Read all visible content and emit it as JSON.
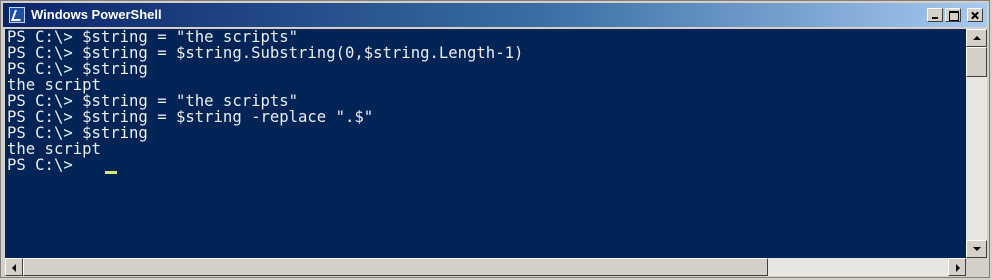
{
  "window": {
    "title": "Windows PowerShell",
    "icon": "powershell-icon"
  },
  "console": {
    "background": "#012456",
    "foreground": "#eeedf0",
    "cursor_color": "#d6e87c",
    "lines": [
      "PS C:\\> $string = \"the scripts\"",
      "PS C:\\> $string = $string.Substring(0,$string.Length-1)",
      "PS C:\\> $string",
      "the script",
      "PS C:\\> $string = \"the scripts\"",
      "PS C:\\> $string = $string -replace \".$\"",
      "PS C:\\> $string",
      "the script",
      "PS C:\\> "
    ]
  }
}
